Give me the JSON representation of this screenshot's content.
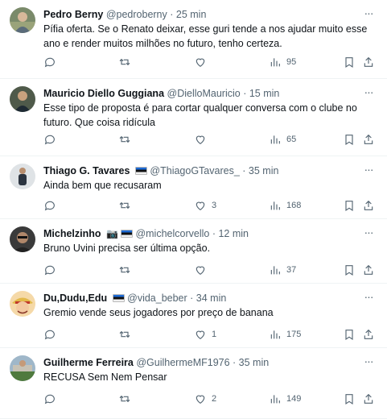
{
  "tweets": [
    {
      "name": "Pedro Berny",
      "handle": "@pedroberny",
      "time": "· 25 min",
      "text": "Pífia oferta. Se o Renato deixar, esse guri tende a nos ajudar muito esse ano e render muitos milhões no futuro, tenho certeza.",
      "likes": "",
      "views": "95",
      "flag": false,
      "camera": false,
      "avatar": "photo-man-outdoor"
    },
    {
      "name": "Mauricio Diello Guggiana",
      "handle": "@DielloMauricio",
      "time": "· 15 min",
      "text": "Esse tipo de proposta é para cortar qualquer conversa com o clube no futuro. Que coisa ridícula",
      "likes": "",
      "views": "65",
      "flag": false,
      "camera": false,
      "avatar": "photo-man-dark"
    },
    {
      "name": "Thiago G. Tavares",
      "handle": "@ThiagoGTavares_",
      "time": "· 35 min",
      "text": "Ainda bem que recusaram",
      "likes": "3",
      "views": "168",
      "flag": true,
      "camera": false,
      "avatar": "photo-person-standing"
    },
    {
      "name": "Michelzinho",
      "handle": "@michelcorvello",
      "time": "· 12 min",
      "text": "Bruno Uvini precisa ser última opção.",
      "likes": "",
      "views": "37",
      "flag": true,
      "camera": true,
      "avatar": "photo-man-glasses"
    },
    {
      "name": "Du,Dudu,Edu",
      "handle": "@vida_beber",
      "time": "· 34 min",
      "text": "Gremio vende seus jogadores por preço de banana",
      "likes": "1",
      "views": "175",
      "flag": true,
      "camera": false,
      "avatar": "cartoon-straw-hat"
    },
    {
      "name": "Guilherme Ferreira",
      "handle": "@GuilhermeMF1976",
      "time": "· 35 min",
      "text": "RECUSA Sem Nem Pensar",
      "likes": "2",
      "views": "149",
      "flag": false,
      "camera": false,
      "avatar": "photo-stadium"
    }
  ],
  "icons": {
    "reply": "reply-icon",
    "retweet": "retweet-icon",
    "like": "heart-icon",
    "views": "views-chart-icon",
    "bookmark": "bookmark-icon",
    "share": "share-icon",
    "more": "more-icon"
  },
  "colors": {
    "text": "#0f1419",
    "secondary": "#536471",
    "divider": "#eff3f4"
  }
}
